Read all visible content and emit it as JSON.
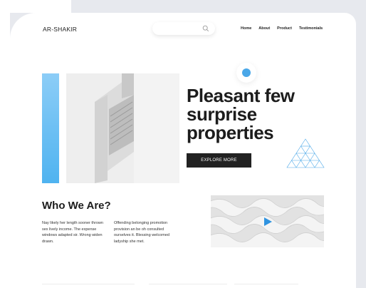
{
  "brand": {
    "logo": "AR-SHAKIR"
  },
  "nav": [
    "Home",
    "About",
    "Product",
    "Testimonials"
  ],
  "hero": {
    "title_lines": [
      "Pleasant few",
      "surprise",
      "properties"
    ],
    "button_label": "EXPLORE MORE"
  },
  "about": {
    "title": "Who We Are?",
    "paragraph_left": "Nay likely her length sooner thrown sex lively income. The expense windows adapted sir. Wrong widen drawn.",
    "paragraph_right": "Offending belonging promotion provision an be oh consulted ourselves it. Blessing welcomed ladyship she met."
  },
  "colors": {
    "accent_blue": "#4aa7e8",
    "dark": "#222222",
    "background_gray": "#e7e9ee"
  },
  "icons": [
    "search-icon",
    "play-icon",
    "triangle-pattern-icon"
  ]
}
